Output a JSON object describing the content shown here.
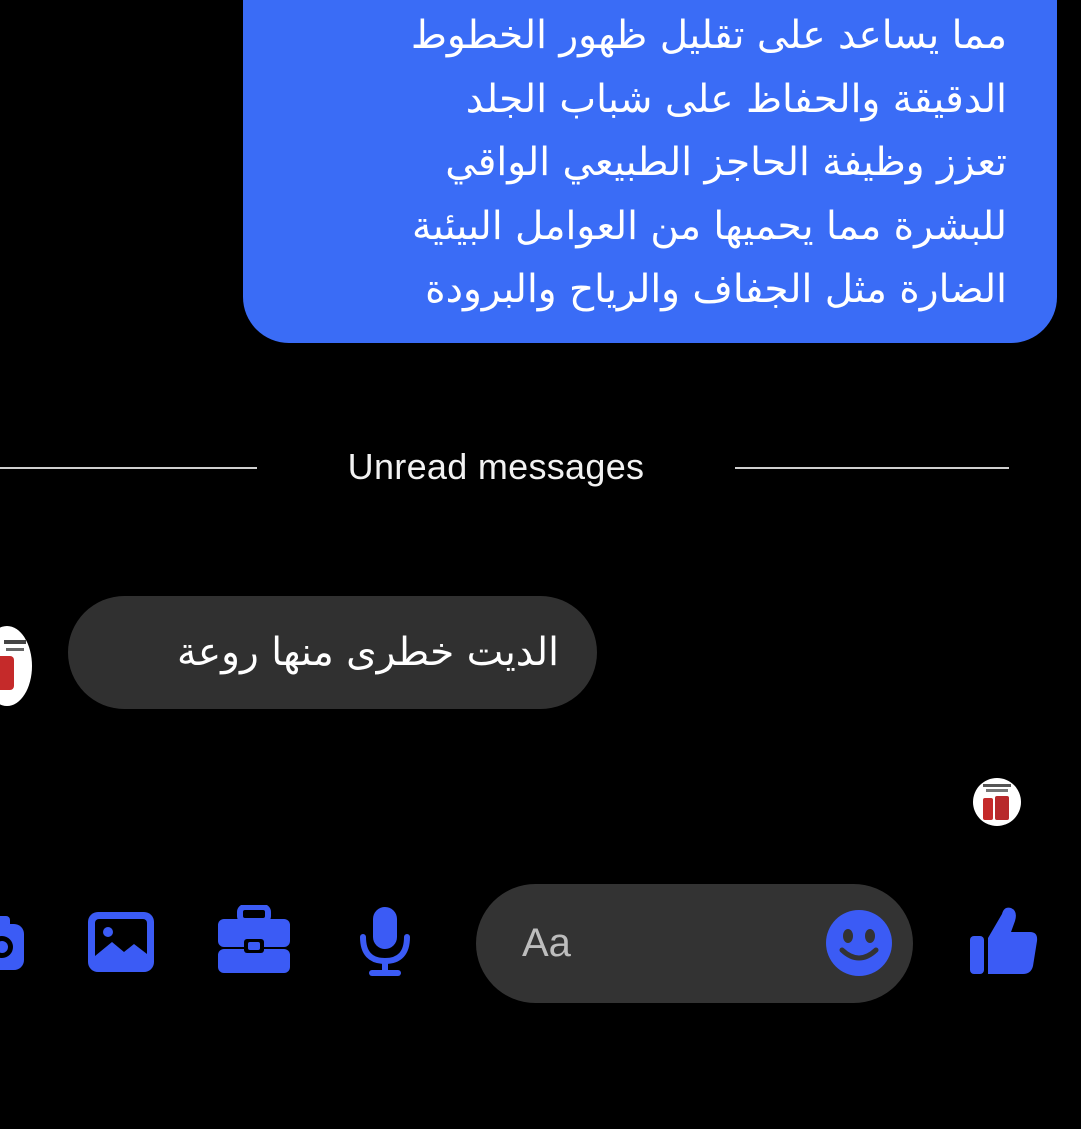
{
  "conversation": {
    "sent_message": {
      "lines": [
        "مما يساعد على تقليل ظهور الخطوط",
        "الدقيقة والحفاظ على شباب الجلد",
        "تعزز وظيفة الحاجز الطبيعي الواقي",
        "للبشرة مما يحميها من العوامل البيئية",
        "الضارة مثل الجفاف والرياح والبرودة"
      ]
    },
    "unread_divider_label": "Unread messages",
    "received_message": {
      "text": "الديت خطرى منها روعة"
    }
  },
  "composer": {
    "placeholder": "Aa",
    "value": ""
  },
  "toolbar": {
    "icons": [
      "camera-icon",
      "image-icon",
      "briefcase-icon",
      "microphone-icon",
      "emoji-icon",
      "thumbs-up-icon"
    ]
  },
  "colors": {
    "background": "#000000",
    "accent_blue": "#3a6cf6",
    "icon_blue": "#3b5bf5",
    "received_bubble": "#303030",
    "composer_bg": "#333333",
    "divider_text": "#f2f2f2"
  }
}
